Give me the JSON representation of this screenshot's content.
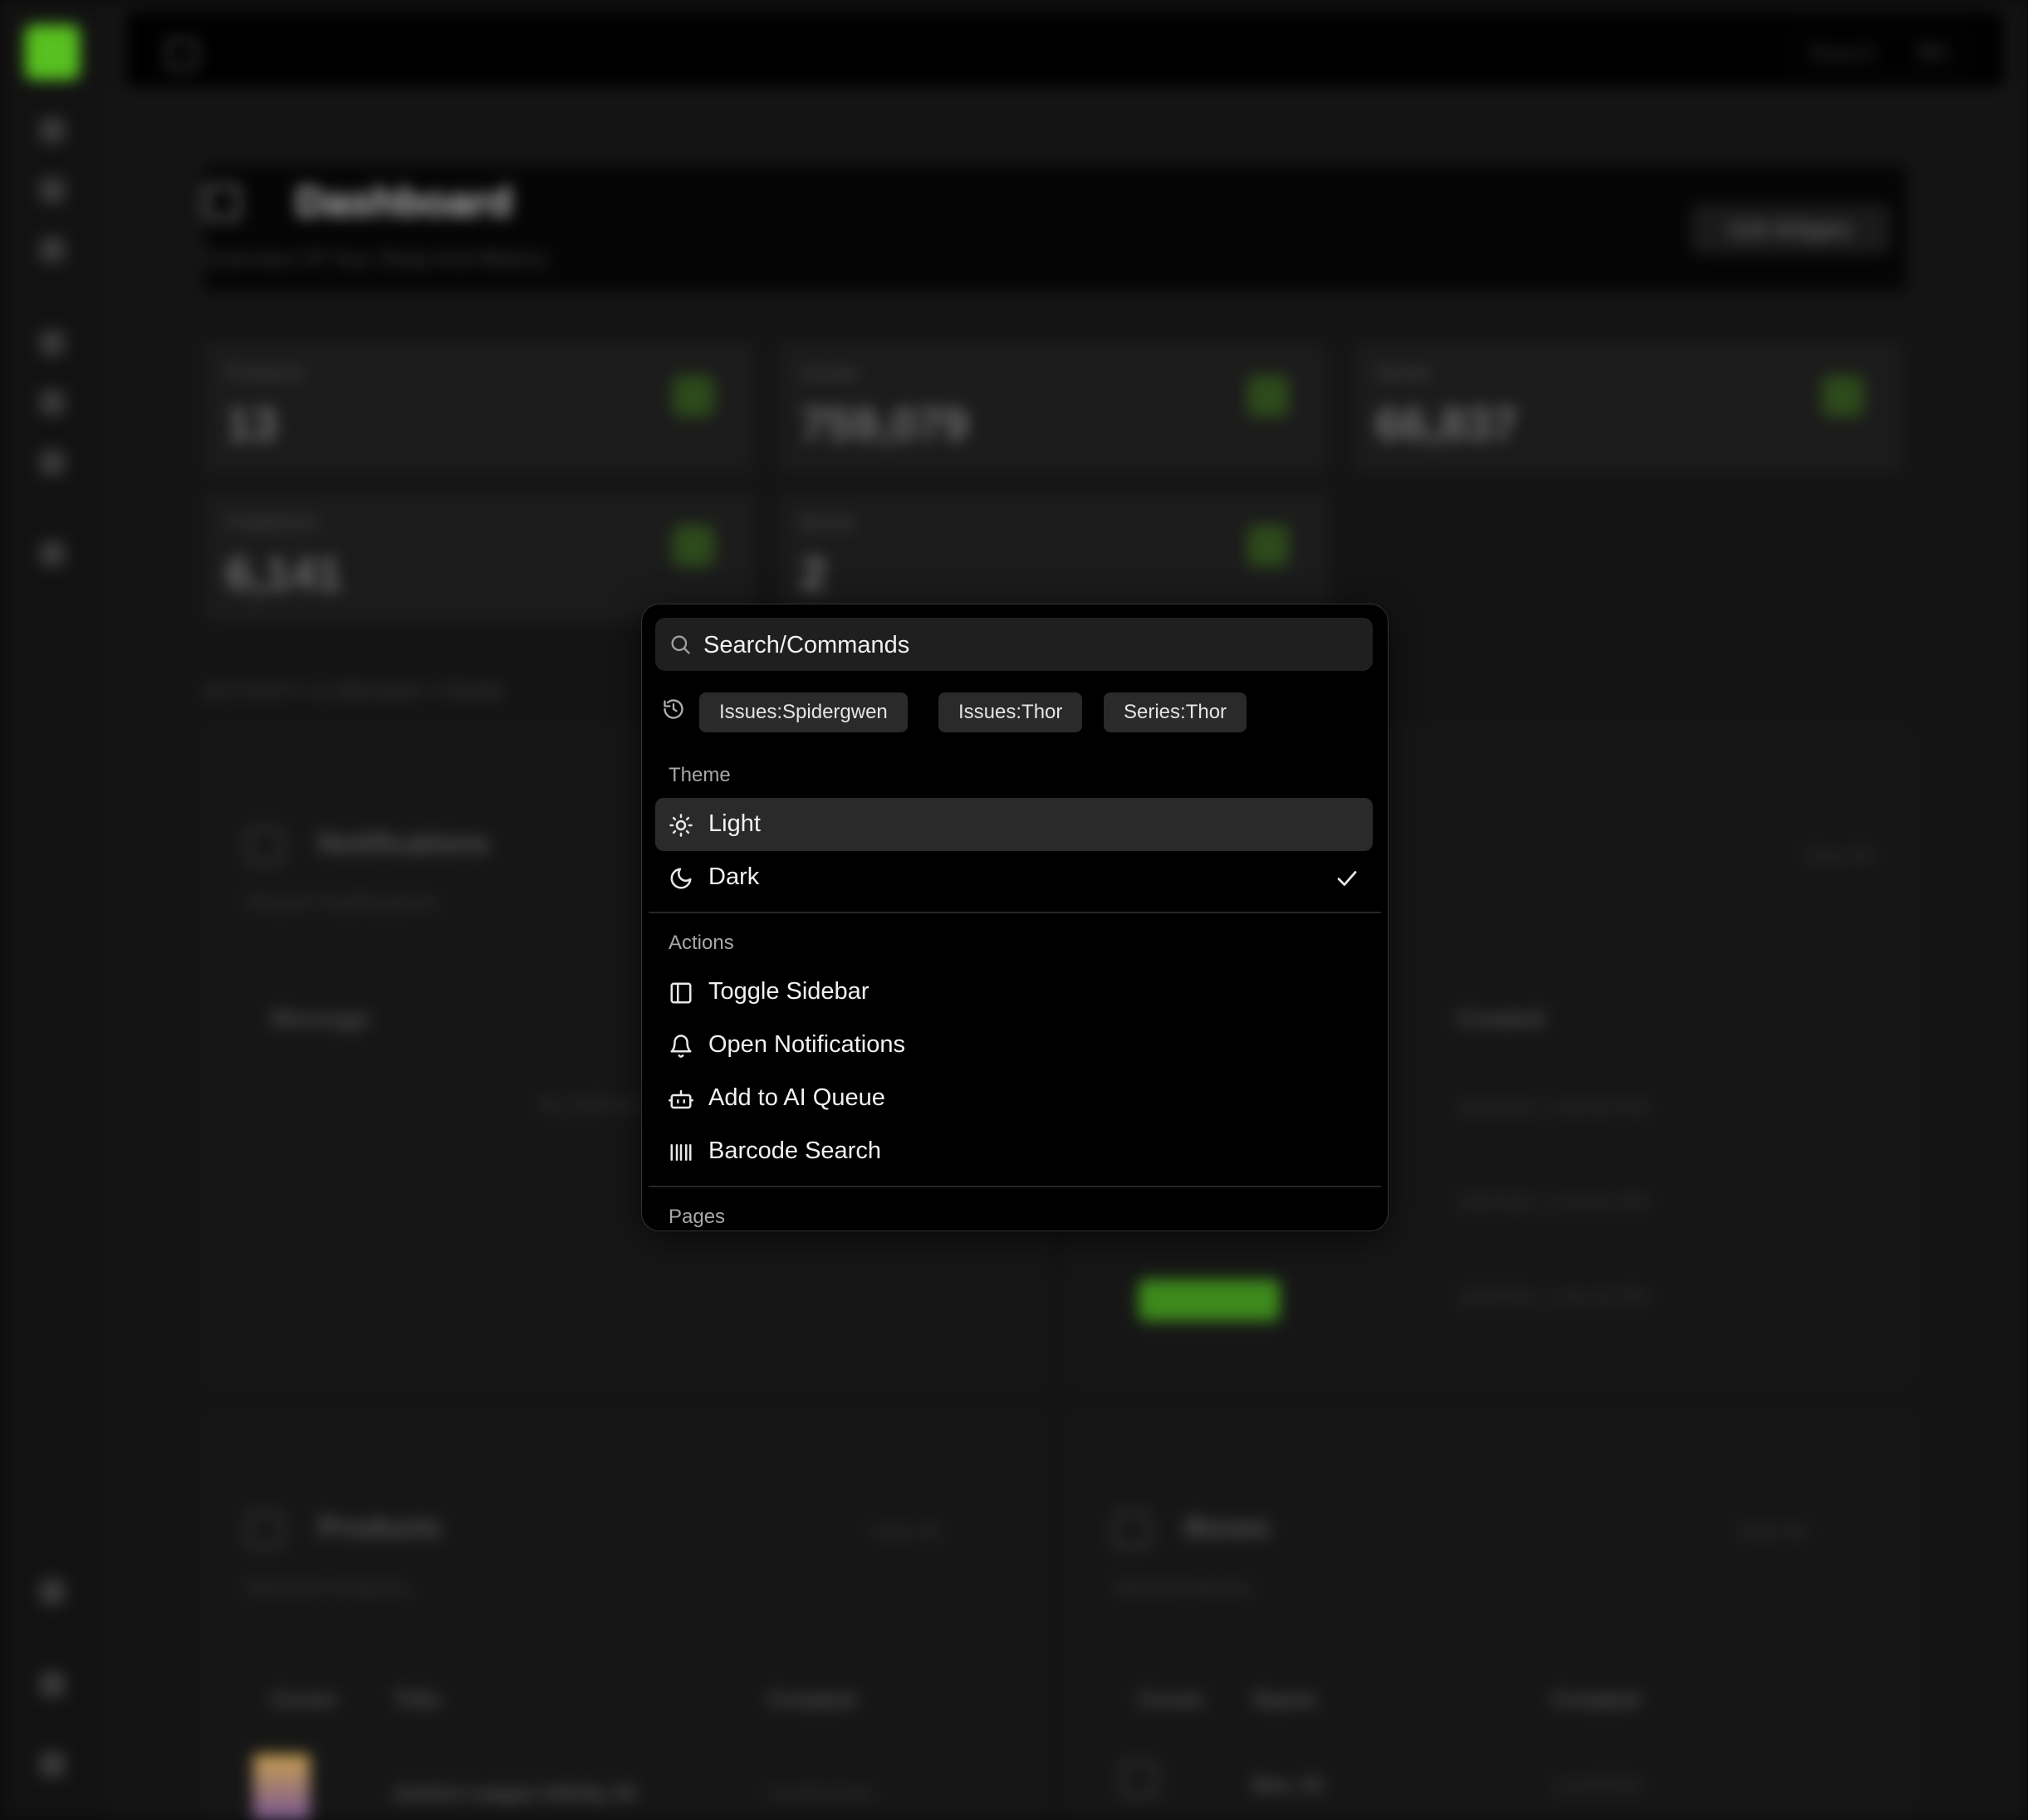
{
  "background": {
    "page_title": "Dashboard",
    "page_subtitle": "Overview Of Your Shop And Metrics",
    "edit_widgets_label": "Edit Widgets",
    "top_search_label": "Search",
    "top_search_kbd": "⌘K",
    "stats": [
      {
        "label": "Products",
        "value": "13"
      },
      {
        "label": "Issues",
        "value": "759,079"
      },
      {
        "label": "Series",
        "value": "66,837"
      },
      {
        "label": "Publishers",
        "value": "6,141"
      },
      {
        "label": "Boxes",
        "value": "2"
      }
    ],
    "section_label": "ACTIVITY & RECENT ITEMS",
    "notifications": {
      "title": "Notifications",
      "subtitle": "Recent Notifications",
      "col_message": "Message",
      "empty_text": "No Notifications"
    },
    "jobs": {
      "view_all": "View All",
      "col_created": "Created",
      "rows": [
        "2/8/2026, 2:40:43 PM",
        "2/8/2026, 2:40:43 PM",
        "2/8/2026, 2:40:43 PM"
      ],
      "status_label": "Completed"
    },
    "products": {
      "title": "Products",
      "subtitle": "Newest Products",
      "view_all": "View All",
      "col_cover": "Cover",
      "col_title": "Title",
      "col_created": "Created",
      "row_title": "Justice League Infinity #6",
      "row_created": "Invalid Date"
    },
    "boxes": {
      "title": "Boxes",
      "subtitle": "Newest Boxes",
      "view_all": "View All",
      "col_cover": "Cover",
      "col_name": "Name",
      "col_created": "Created",
      "row_name": "Box_01",
      "row_created": "1/24/2026"
    }
  },
  "palette": {
    "search_placeholder": "Search/Commands",
    "recent": [
      "Issues:Spidergwen",
      "Issues:Thor",
      "Series:Thor"
    ],
    "theme_heading": "Theme",
    "theme_items": [
      {
        "label": "Light",
        "icon": "sun-icon"
      },
      {
        "label": "Dark",
        "icon": "moon-icon",
        "checked": true
      }
    ],
    "actions_heading": "Actions",
    "action_items": [
      {
        "label": "Toggle Sidebar",
        "icon": "sidebar-icon"
      },
      {
        "label": "Open Notifications",
        "icon": "bell-icon"
      },
      {
        "label": "Add to AI Queue",
        "icon": "robot-icon"
      },
      {
        "label": "Barcode Search",
        "icon": "barcode-icon"
      }
    ],
    "pages_heading": "Pages"
  }
}
